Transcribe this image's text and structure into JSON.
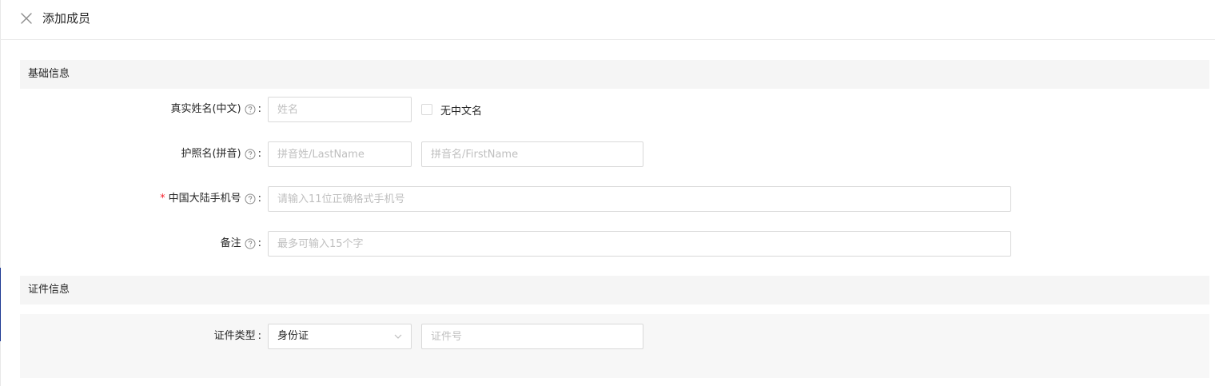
{
  "header": {
    "title": "添加成员",
    "close_icon": "close-icon"
  },
  "sections": {
    "basic": {
      "title": "基础信息"
    },
    "id": {
      "title": "证件信息"
    }
  },
  "form": {
    "real_name": {
      "label": "真实姓名(中文)",
      "placeholder": "姓名",
      "checkbox_label": "无中文名",
      "checked": false
    },
    "passport_name": {
      "label": "护照名(拼音)",
      "last_placeholder": "拼音姓/LastName",
      "first_placeholder": "拼音名/FirstName"
    },
    "phone": {
      "required_mark": "*",
      "label": "中国大陆手机号",
      "placeholder": "请输入11位正确格式手机号"
    },
    "remark": {
      "label": "备注",
      "placeholder": "最多可输入15个字"
    },
    "id_type": {
      "label": "证件类型",
      "selected": "身份证",
      "number_placeholder": "证件号"
    },
    "colon": ":"
  },
  "colors": {
    "required": "#f5222d",
    "border": "#d9d9d9",
    "section_bg": "#f5f5f5",
    "placeholder": "#bfbfbf"
  }
}
